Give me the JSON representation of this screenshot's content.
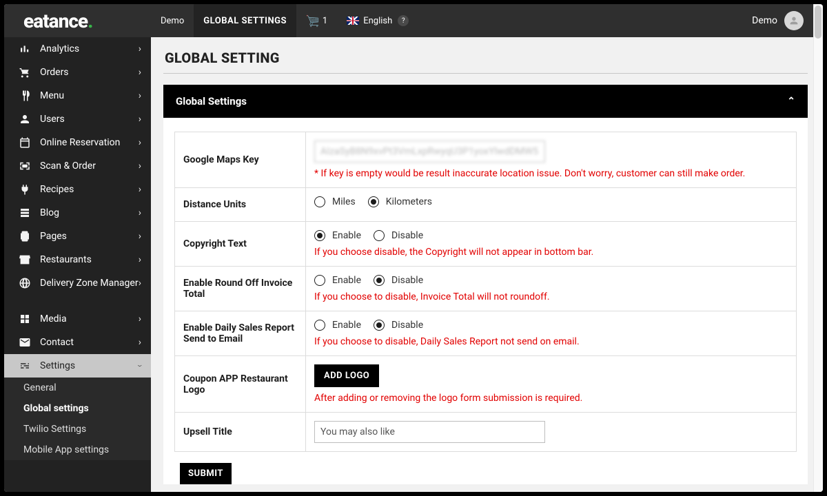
{
  "topbar": {
    "logo_text": "eatance",
    "nav": [
      {
        "label": "Demo",
        "active": false
      },
      {
        "label": "GLOBAL SETTINGS",
        "active": true
      }
    ],
    "cart_count": "1",
    "language": "English",
    "user_label": "Demo"
  },
  "sidebar": {
    "items": [
      {
        "label": "Analytics",
        "icon": "analytics-icon"
      },
      {
        "label": "Orders",
        "icon": "cart-icon"
      },
      {
        "label": "Menu",
        "icon": "menu-icon"
      },
      {
        "label": "Users",
        "icon": "users-icon"
      },
      {
        "label": "Online Reservation",
        "icon": "calendar-icon"
      },
      {
        "label": "Scan & Order",
        "icon": "scan-icon"
      },
      {
        "label": "Recipes",
        "icon": "plug-icon"
      },
      {
        "label": "Blog",
        "icon": "blog-icon"
      },
      {
        "label": "Pages",
        "icon": "pages-icon"
      },
      {
        "label": "Restaurants",
        "icon": "store-icon"
      },
      {
        "label": "Delivery Zone Manager",
        "icon": "globe-icon"
      },
      {
        "label": "Media",
        "icon": "media-icon"
      },
      {
        "label": "Contact",
        "icon": "contact-icon"
      },
      {
        "label": "Settings",
        "icon": "settings-icon",
        "active": true
      }
    ],
    "sub_items": [
      {
        "label": "General"
      },
      {
        "label": "Global settings",
        "selected": true
      },
      {
        "label": "Twilio Settings"
      },
      {
        "label": "Mobile App settings"
      }
    ]
  },
  "page": {
    "title": "GLOBAL SETTING"
  },
  "panel": {
    "title": "Global Settings"
  },
  "form": {
    "rows": [
      {
        "label": "Google Maps Key",
        "type": "text",
        "value": "AIzaSyB8N9xvPt3VmLxpRwyqU3P1yoxYlwdDMW5LP",
        "blurred": true,
        "hint": "* If key is empty would be result inaccurate location issue. Don't worry, customer can still make order."
      },
      {
        "label": "Distance Units",
        "type": "radio",
        "options": [
          {
            "label": "Miles",
            "checked": false
          },
          {
            "label": "Kilometers",
            "checked": true
          }
        ]
      },
      {
        "label": "Copyright Text",
        "type": "radio",
        "options": [
          {
            "label": "Enable",
            "checked": true
          },
          {
            "label": "Disable",
            "checked": false
          }
        ],
        "hint": "If you choose disable, the Copyright will not appear in bottom bar."
      },
      {
        "label": "Enable Round Off Invoice Total",
        "type": "radio",
        "options": [
          {
            "label": "Enable",
            "checked": false
          },
          {
            "label": "Disable",
            "checked": true
          }
        ],
        "hint": "If you choose to disable, Invoice Total will not roundoff."
      },
      {
        "label": "Enable Daily Sales Report Send to Email",
        "type": "radio",
        "options": [
          {
            "label": "Enable",
            "checked": false
          },
          {
            "label": "Disable",
            "checked": true
          }
        ],
        "hint": "If you choose to disable, Daily Sales Report not send on email."
      },
      {
        "label": "Coupon APP Restaurant Logo",
        "type": "button",
        "button_label": "ADD LOGO",
        "hint": "After adding or removing the logo form submission is required."
      },
      {
        "label": "Upsell Title",
        "type": "text",
        "value": "You may also like"
      }
    ],
    "submit_label": "SUBMIT"
  }
}
